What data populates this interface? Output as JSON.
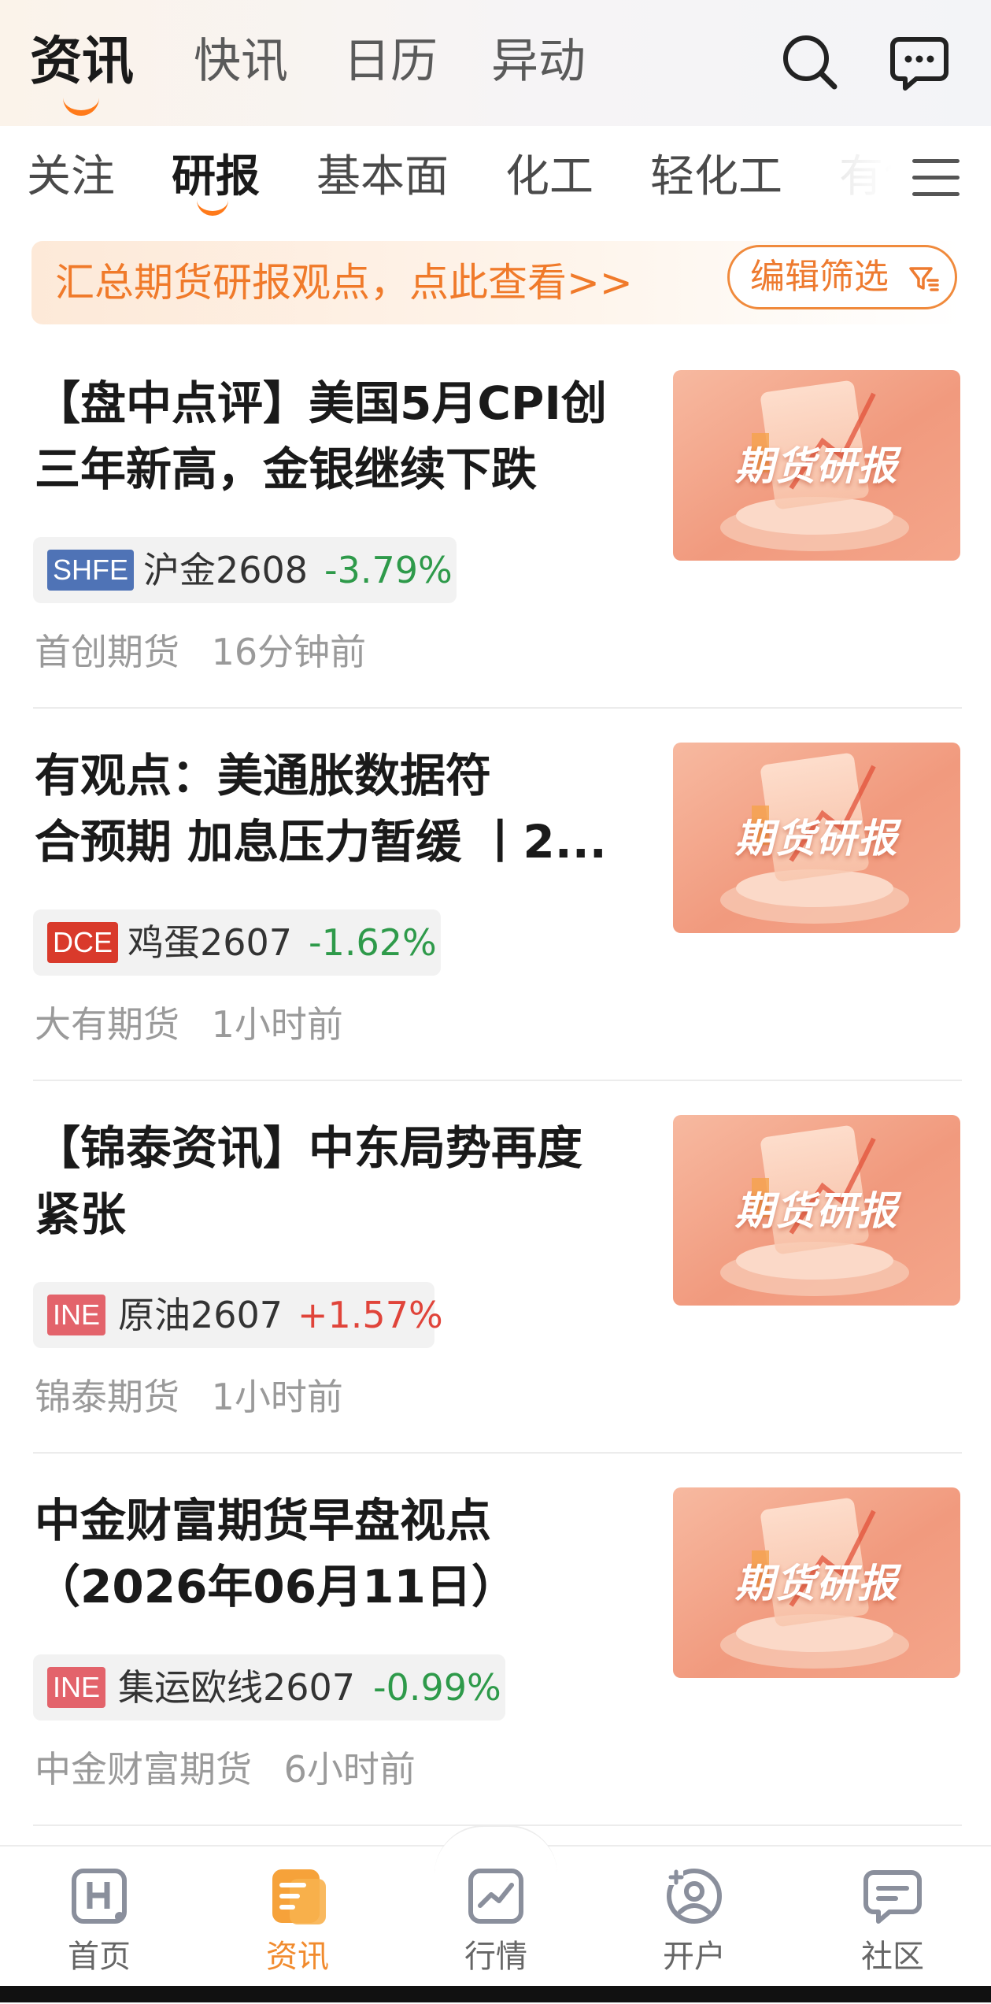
{
  "top_tabs": [
    {
      "label": "资讯",
      "active": true
    },
    {
      "label": "快讯",
      "active": false
    },
    {
      "label": "日历",
      "active": false
    },
    {
      "label": "异动",
      "active": false
    }
  ],
  "sub_tabs": [
    {
      "label": "关注",
      "active": false
    },
    {
      "label": "研报",
      "active": true
    },
    {
      "label": "基本面",
      "active": false
    },
    {
      "label": "化工",
      "active": false
    },
    {
      "label": "轻化工",
      "active": false
    },
    {
      "label": "有色",
      "active": false
    }
  ],
  "banner": {
    "text": "汇总期货研报观点，点此查看>>",
    "filter_label": "编辑筛选"
  },
  "thumbnail_label": "期货研报",
  "articles": [
    {
      "title_line1": "【盘中点评】美国5月CPI创",
      "title_line2": "三年新高，金银继续下跌",
      "exchange": "SHFE",
      "contract": "沪金2608",
      "change": "-3.79%",
      "source": "首创期货",
      "time": "16分钟前"
    },
    {
      "title_line1": "有观点：美通胀数据符",
      "title_line2": "合预期 加息压力暂缓 丨2...",
      "exchange": "DCE",
      "contract": "鸡蛋2607",
      "change": "-1.62%",
      "source": "大有期货",
      "time": "1小时前"
    },
    {
      "title_line1": "【锦泰资讯】中东局势再度",
      "title_line2": "紧张",
      "exchange": "INE",
      "contract": "原油2607",
      "change": "+1.57%",
      "source": "锦泰期货",
      "time": "1小时前"
    },
    {
      "title_line1": "中金财富期货早盘视点",
      "title_line2": "（2026年06月11日）",
      "exchange": "INE",
      "contract": "集运欧线2607",
      "change": "-0.99%",
      "source": "中金财富期货",
      "time": "6小时前"
    }
  ],
  "bottom_nav": [
    {
      "label": "首页",
      "icon": "home-h-icon",
      "active": false
    },
    {
      "label": "资讯",
      "icon": "news-icon",
      "active": true
    },
    {
      "label": "行情",
      "icon": "market-chart-icon",
      "active": false
    },
    {
      "label": "开户",
      "icon": "open-account-icon",
      "active": false
    },
    {
      "label": "社区",
      "icon": "community-chat-icon",
      "active": false
    }
  ],
  "colors": {
    "accent": "#f18b2e",
    "down": "#2e9a4a",
    "up": "#e0443a",
    "shfe": "#4f73b6",
    "dce": "#d93a2b",
    "ine": "#e3636b"
  }
}
